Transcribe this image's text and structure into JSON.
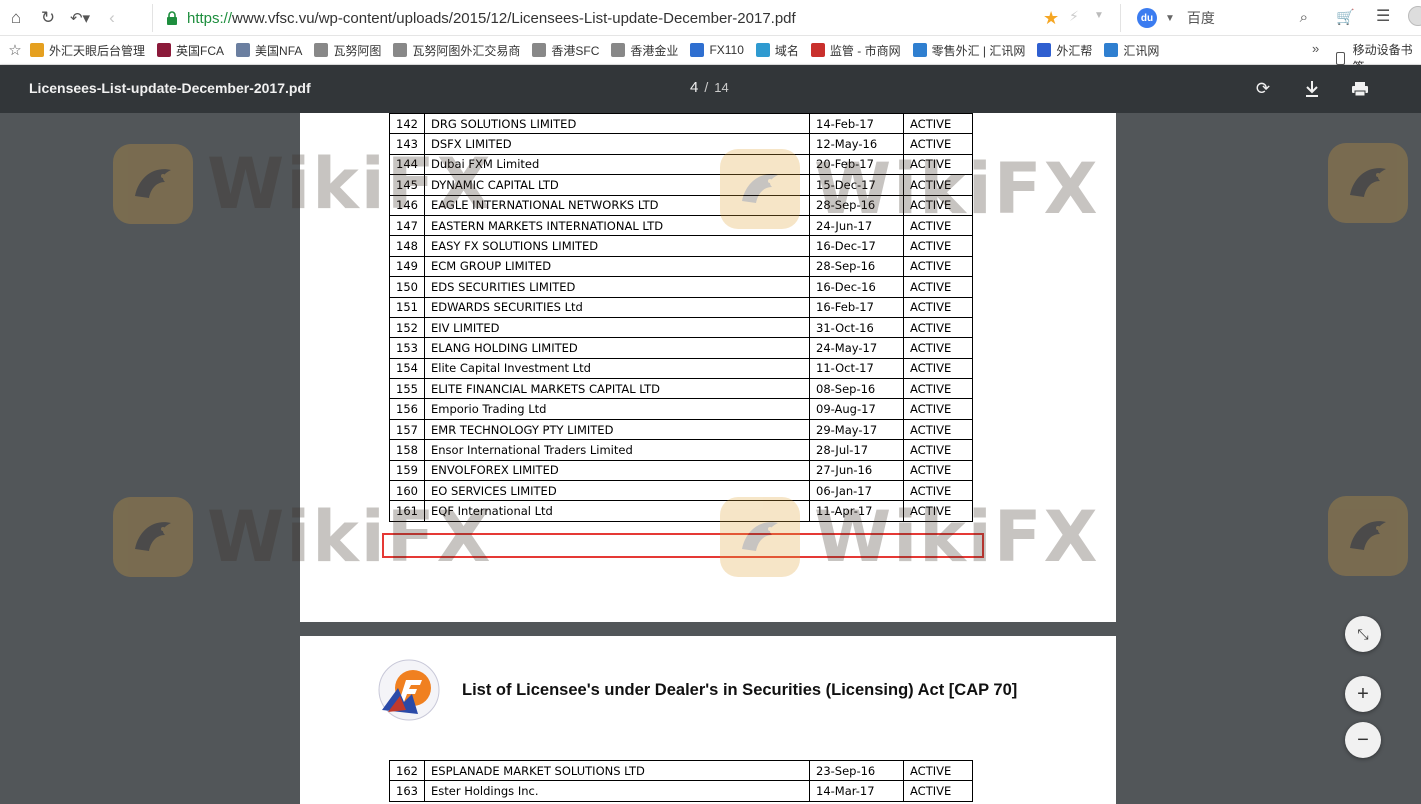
{
  "browser": {
    "url_scheme": "https://",
    "url_rest": "www.vfsc.vu/wp-content/uploads/2015/12/Licensees-List-update-December-2017.pdf",
    "search_engine": "百度",
    "bookmarks": [
      {
        "label": "外汇天眼后台管理",
        "color": "#e5a020"
      },
      {
        "label": "英国FCA",
        "color": "#8b1a3a"
      },
      {
        "label": "美国NFA",
        "color": "#6b7fa0"
      },
      {
        "label": "瓦努阿图",
        "color": "#888888"
      },
      {
        "label": "瓦努阿图外汇交易商",
        "color": "#888888"
      },
      {
        "label": "香港SFC",
        "color": "#888888"
      },
      {
        "label": "香港金业",
        "color": "#888888"
      },
      {
        "label": "FX110",
        "color": "#2f6fd0"
      },
      {
        "label": "域名",
        "color": "#2f9ad0"
      },
      {
        "label": "监管 - 市商网",
        "color": "#c9302c"
      },
      {
        "label": "零售外汇 | 汇讯网",
        "color": "#2f7fd0"
      },
      {
        "label": "外汇帮",
        "color": "#2f5fd0"
      },
      {
        "label": "汇讯网",
        "color": "#2f7fd0"
      }
    ],
    "bookmarks_more": "»",
    "mobile_bookmarks": "移动设备书签"
  },
  "viewer": {
    "title": "Licensees-List-update-December-2017.pdf",
    "current_page": "4",
    "separator": "/",
    "total_pages": "14"
  },
  "page1_rows": [
    {
      "num": "142",
      "name": "DRG SOLUTIONS LIMITED",
      "date": "14-Feb-17",
      "status": "ACTIVE"
    },
    {
      "num": "143",
      "name": "DSFX LIMITED",
      "date": "12-May-16",
      "status": "ACTIVE"
    },
    {
      "num": "144",
      "name": "Dubai FXM Limited",
      "date": "20-Feb-17",
      "status": "ACTIVE"
    },
    {
      "num": "145",
      "name": "DYNAMIC CAPITAL LTD",
      "date": "15-Dec-17",
      "status": "ACTIVE"
    },
    {
      "num": "146",
      "name": "EAGLE INTERNATIONAL NETWORKS LTD",
      "date": "28-Sep-16",
      "status": "ACTIVE"
    },
    {
      "num": "147",
      "name": "EASTERN MARKETS INTERNATIONAL LTD",
      "date": "24-Jun-17",
      "status": "ACTIVE"
    },
    {
      "num": "148",
      "name": "EASY FX SOLUTIONS LIMITED",
      "date": "16-Dec-17",
      "status": "ACTIVE"
    },
    {
      "num": "149",
      "name": "ECM GROUP LIMITED",
      "date": "28-Sep-16",
      "status": "ACTIVE"
    },
    {
      "num": "150",
      "name": "EDS SECURITIES LIMITED",
      "date": "16-Dec-16",
      "status": "ACTIVE"
    },
    {
      "num": "151",
      "name": "EDWARDS SECURITIES Ltd",
      "date": "16-Feb-17",
      "status": "ACTIVE"
    },
    {
      "num": "152",
      "name": "EIV LIMITED",
      "date": "31-Oct-16",
      "status": "ACTIVE"
    },
    {
      "num": "153",
      "name": "ELANG HOLDING LIMITED",
      "date": "24-May-17",
      "status": "ACTIVE"
    },
    {
      "num": "154",
      "name": "Elite Capital Investment Ltd",
      "date": "11-Oct-17",
      "status": "ACTIVE"
    },
    {
      "num": "155",
      "name": "ELITE FINANCIAL MARKETS CAPITAL LTD",
      "date": "08-Sep-16",
      "status": "ACTIVE"
    },
    {
      "num": "156",
      "name": "Emporio Trading Ltd",
      "date": "09-Aug-17",
      "status": "ACTIVE"
    },
    {
      "num": "157",
      "name": "EMR TECHNOLOGY PTY LIMITED",
      "date": "29-May-17",
      "status": "ACTIVE",
      "highlighted": true
    },
    {
      "num": "158",
      "name": "Ensor International Traders Limited",
      "date": "28-Jul-17",
      "status": "ACTIVE"
    },
    {
      "num": "159",
      "name": "ENVOLFOREX LIMITED",
      "date": "27-Jun-16",
      "status": "ACTIVE"
    },
    {
      "num": "160",
      "name": "EO SERVICES LIMITED",
      "date": "06-Jan-17",
      "status": "ACTIVE"
    },
    {
      "num": "161",
      "name": "EQF International Ltd",
      "date": "11-Apr-17",
      "status": "ACTIVE"
    }
  ],
  "page2": {
    "heading": "List of Licensee's under Dealer's in Securities (Licensing) Act [CAP 70]",
    "rows": [
      {
        "num": "162",
        "name": "ESPLANADE MARKET SOLUTIONS LTD",
        "date": "23-Sep-16",
        "status": "ACTIVE"
      },
      {
        "num": "163",
        "name": "Ester Holdings Inc.",
        "date": "14-Mar-17",
        "status": "ACTIVE"
      }
    ]
  },
  "watermark": {
    "text": "WikiFX",
    "color": "#e0a43a"
  },
  "colors": {
    "toolbar": "#323639",
    "background": "#525659",
    "highlight": "#e53935"
  }
}
